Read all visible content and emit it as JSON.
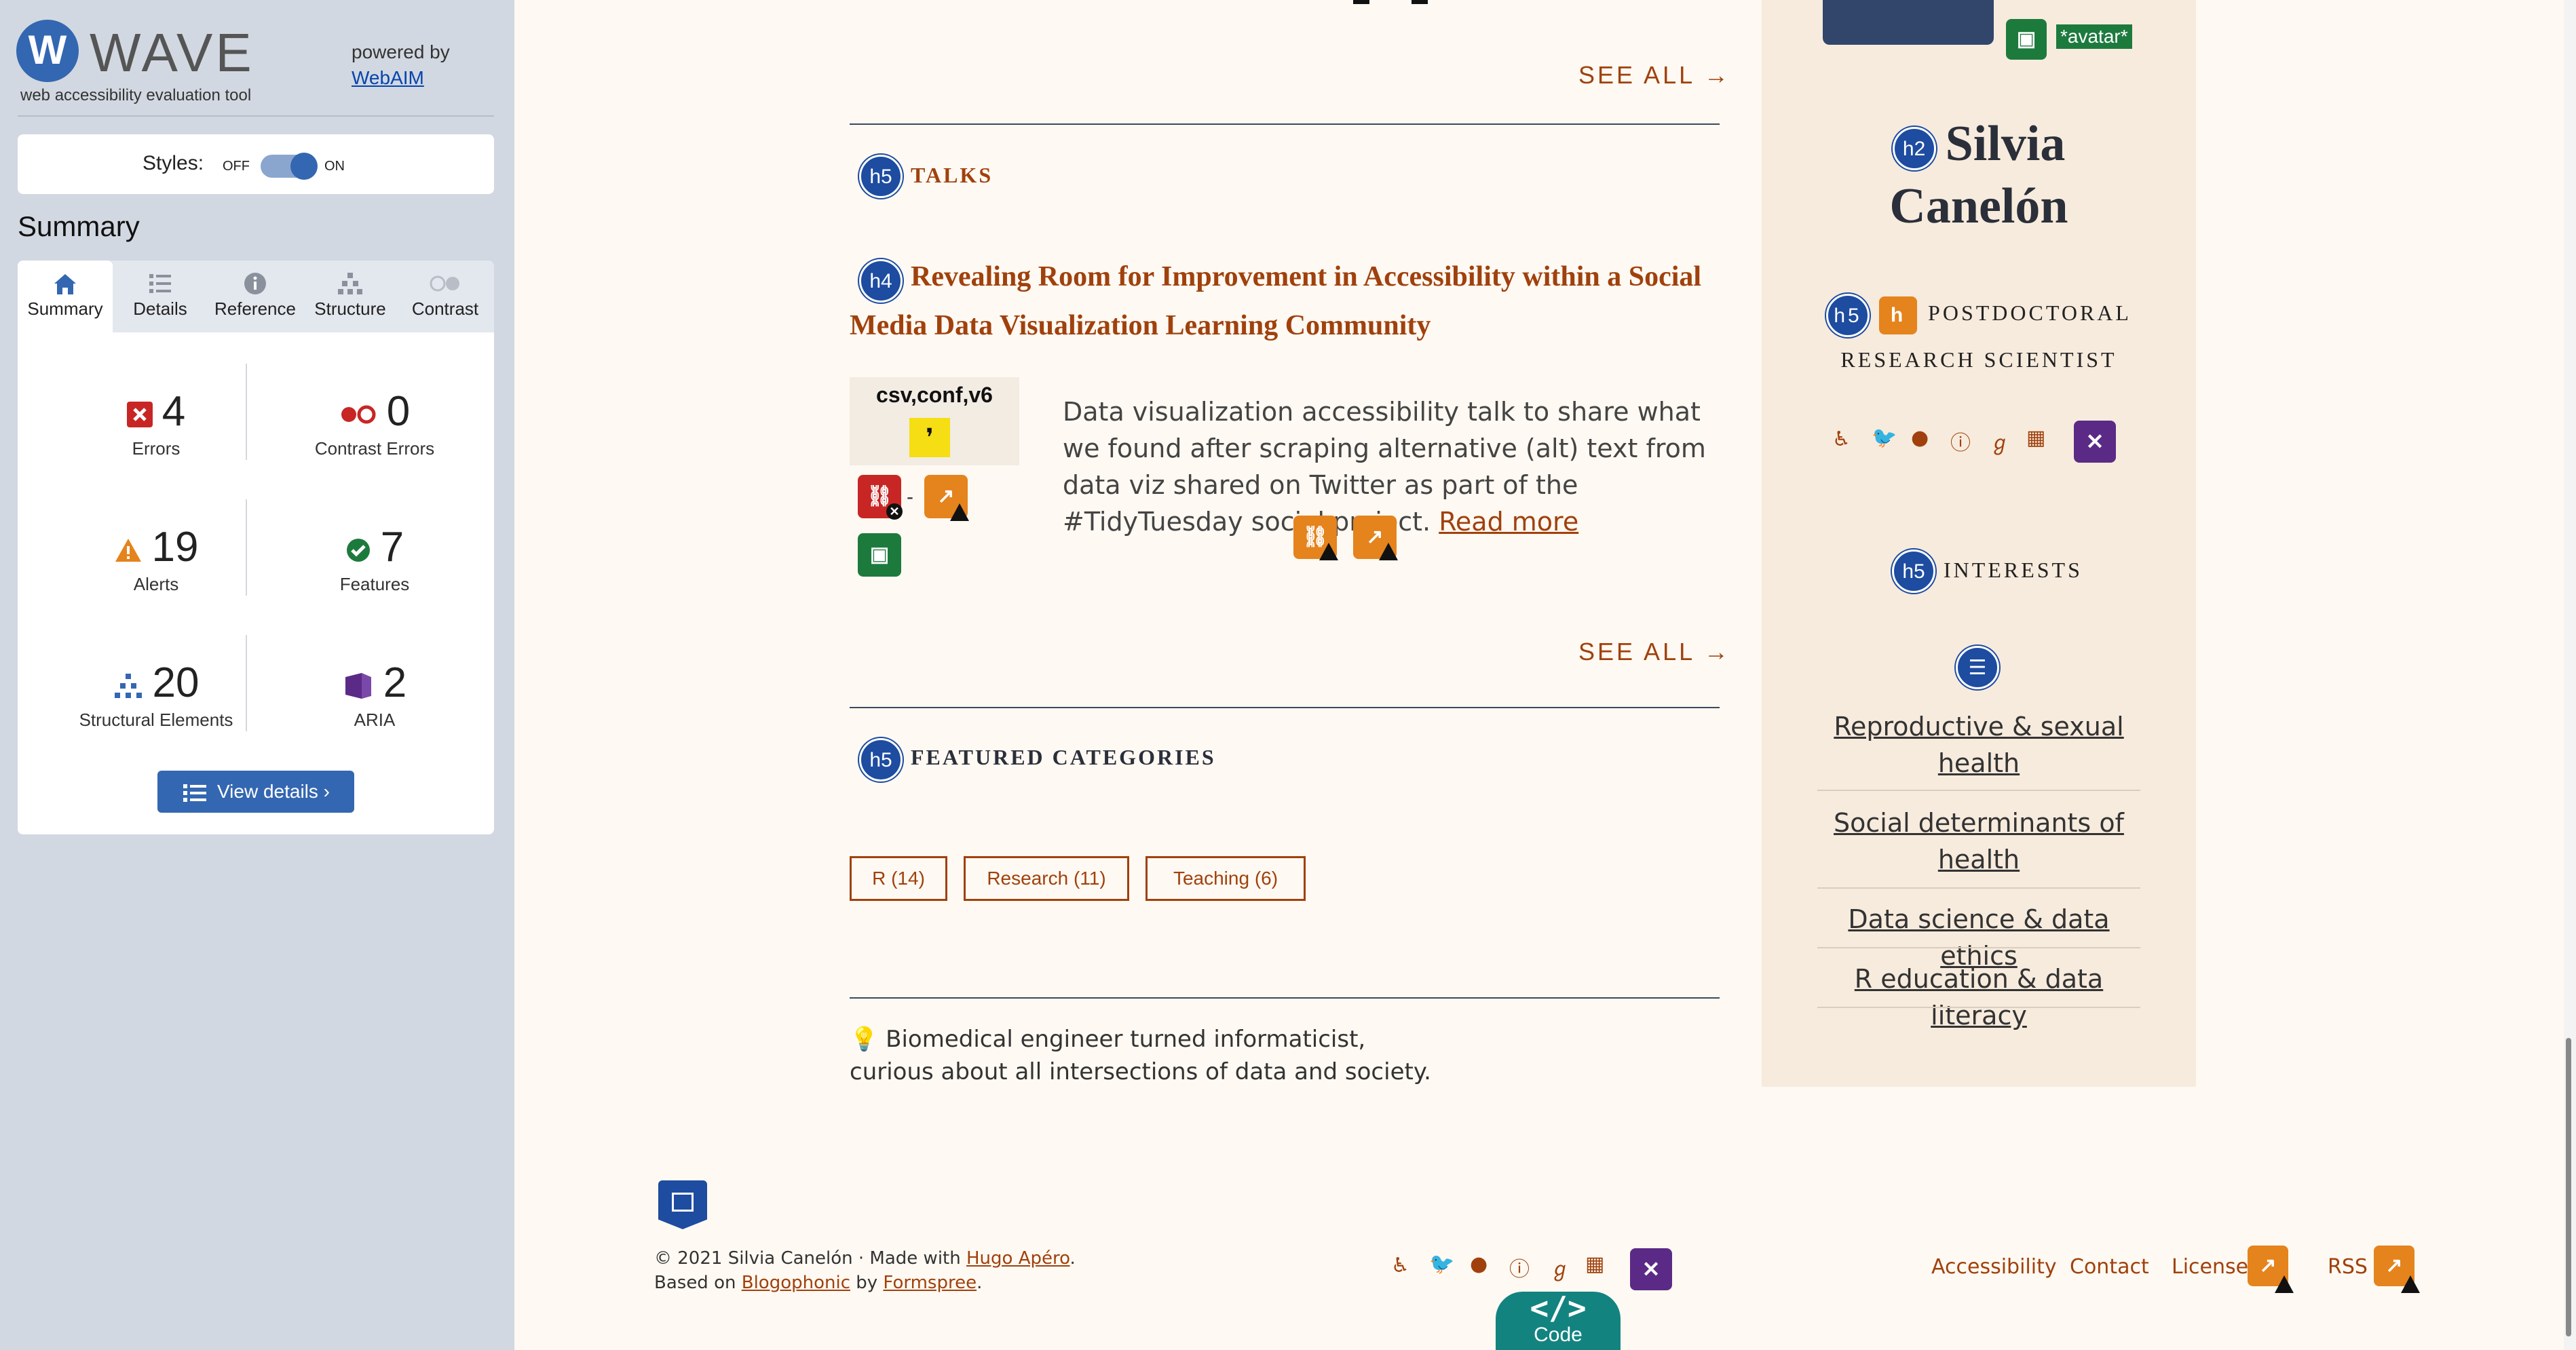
{
  "wave": {
    "logo": "WAVE",
    "logo_letter": "W",
    "subtitle": "web accessibility evaluation tool",
    "powered_by": "powered by",
    "webaim": "WebAIM",
    "styles_label": "Styles:",
    "off": "OFF",
    "on": "ON",
    "summary_title": "Summary",
    "tabs": [
      {
        "label": "Summary",
        "icon": "home-icon"
      },
      {
        "label": "Details",
        "icon": "list-icon"
      },
      {
        "label": "Reference",
        "icon": "info-icon"
      },
      {
        "label": "Structure",
        "icon": "structure-icon"
      },
      {
        "label": "Contrast",
        "icon": "contrast-icon"
      }
    ],
    "stats": {
      "errors": {
        "value": "4",
        "label": "Errors"
      },
      "contrast": {
        "value": "0",
        "label": "Contrast Errors"
      },
      "alerts": {
        "value": "19",
        "label": "Alerts"
      },
      "features": {
        "value": "7",
        "label": "Features"
      },
      "structural": {
        "value": "20",
        "label": "Structural Elements"
      },
      "aria": {
        "value": "2",
        "label": "ARIA"
      }
    },
    "view_details": "View details ›",
    "colors": {
      "primary": "#3467b1",
      "error": "#c82624",
      "alert": "#e5831d",
      "feature": "#1d7a3d",
      "aria": "#5b2a86"
    }
  },
  "content": {
    "see_all_1": "SEE ALL →",
    "talks": {
      "badge": "h5",
      "label": "TALKS"
    },
    "talk": {
      "badge": "h4",
      "title": "Revealing Room for Improvement in Accessibility within a Social Media Data Visualization Learning Community",
      "thumb_label": "csv,conf,v6",
      "desc": "Data visualization accessibility talk to share what we found after scraping alternative (alt) text from data viz shared on Twitter as part of the #TidyTuesday social project.",
      "read_more": "Read more"
    },
    "see_all_2": "SEE ALL →",
    "featured": {
      "badge": "h5",
      "label": "FEATURED CATEGORIES"
    },
    "categories": [
      "R (14)",
      "Research (11)",
      "Teaching (6)"
    ],
    "bio_line1": "Biomedical engineer turned informaticist,",
    "bio_line2": "curious about all intersections of data and society."
  },
  "sidebar": {
    "avatar_tag": "*avatar*",
    "name_badge": "h2",
    "name_line1": "Silvia",
    "name_line2": "Canelón",
    "role_badge": "h5",
    "role_line1": "POSTDOCTORAL",
    "role_line2": "RESEARCH SCIENTIST",
    "interests_badge": "h5",
    "interests_label": "INTERESTS",
    "interests": [
      "Reproductive & sexual health",
      "Social determinants of health",
      "Data science & data ethics",
      "R education & data literacy"
    ]
  },
  "footer": {
    "copyright": "© 2021 Silvia Canelón  ·  Made with",
    "hugo": "Hugo Apéro",
    "based_on": "Based on",
    "blogophonic": "Blogophonic",
    "by": "by",
    "formspree": "Formspree",
    "links": [
      "Accessibility",
      "Contact",
      "License",
      "RSS"
    ],
    "code_label": "Code",
    "code_glyph": "</>"
  }
}
